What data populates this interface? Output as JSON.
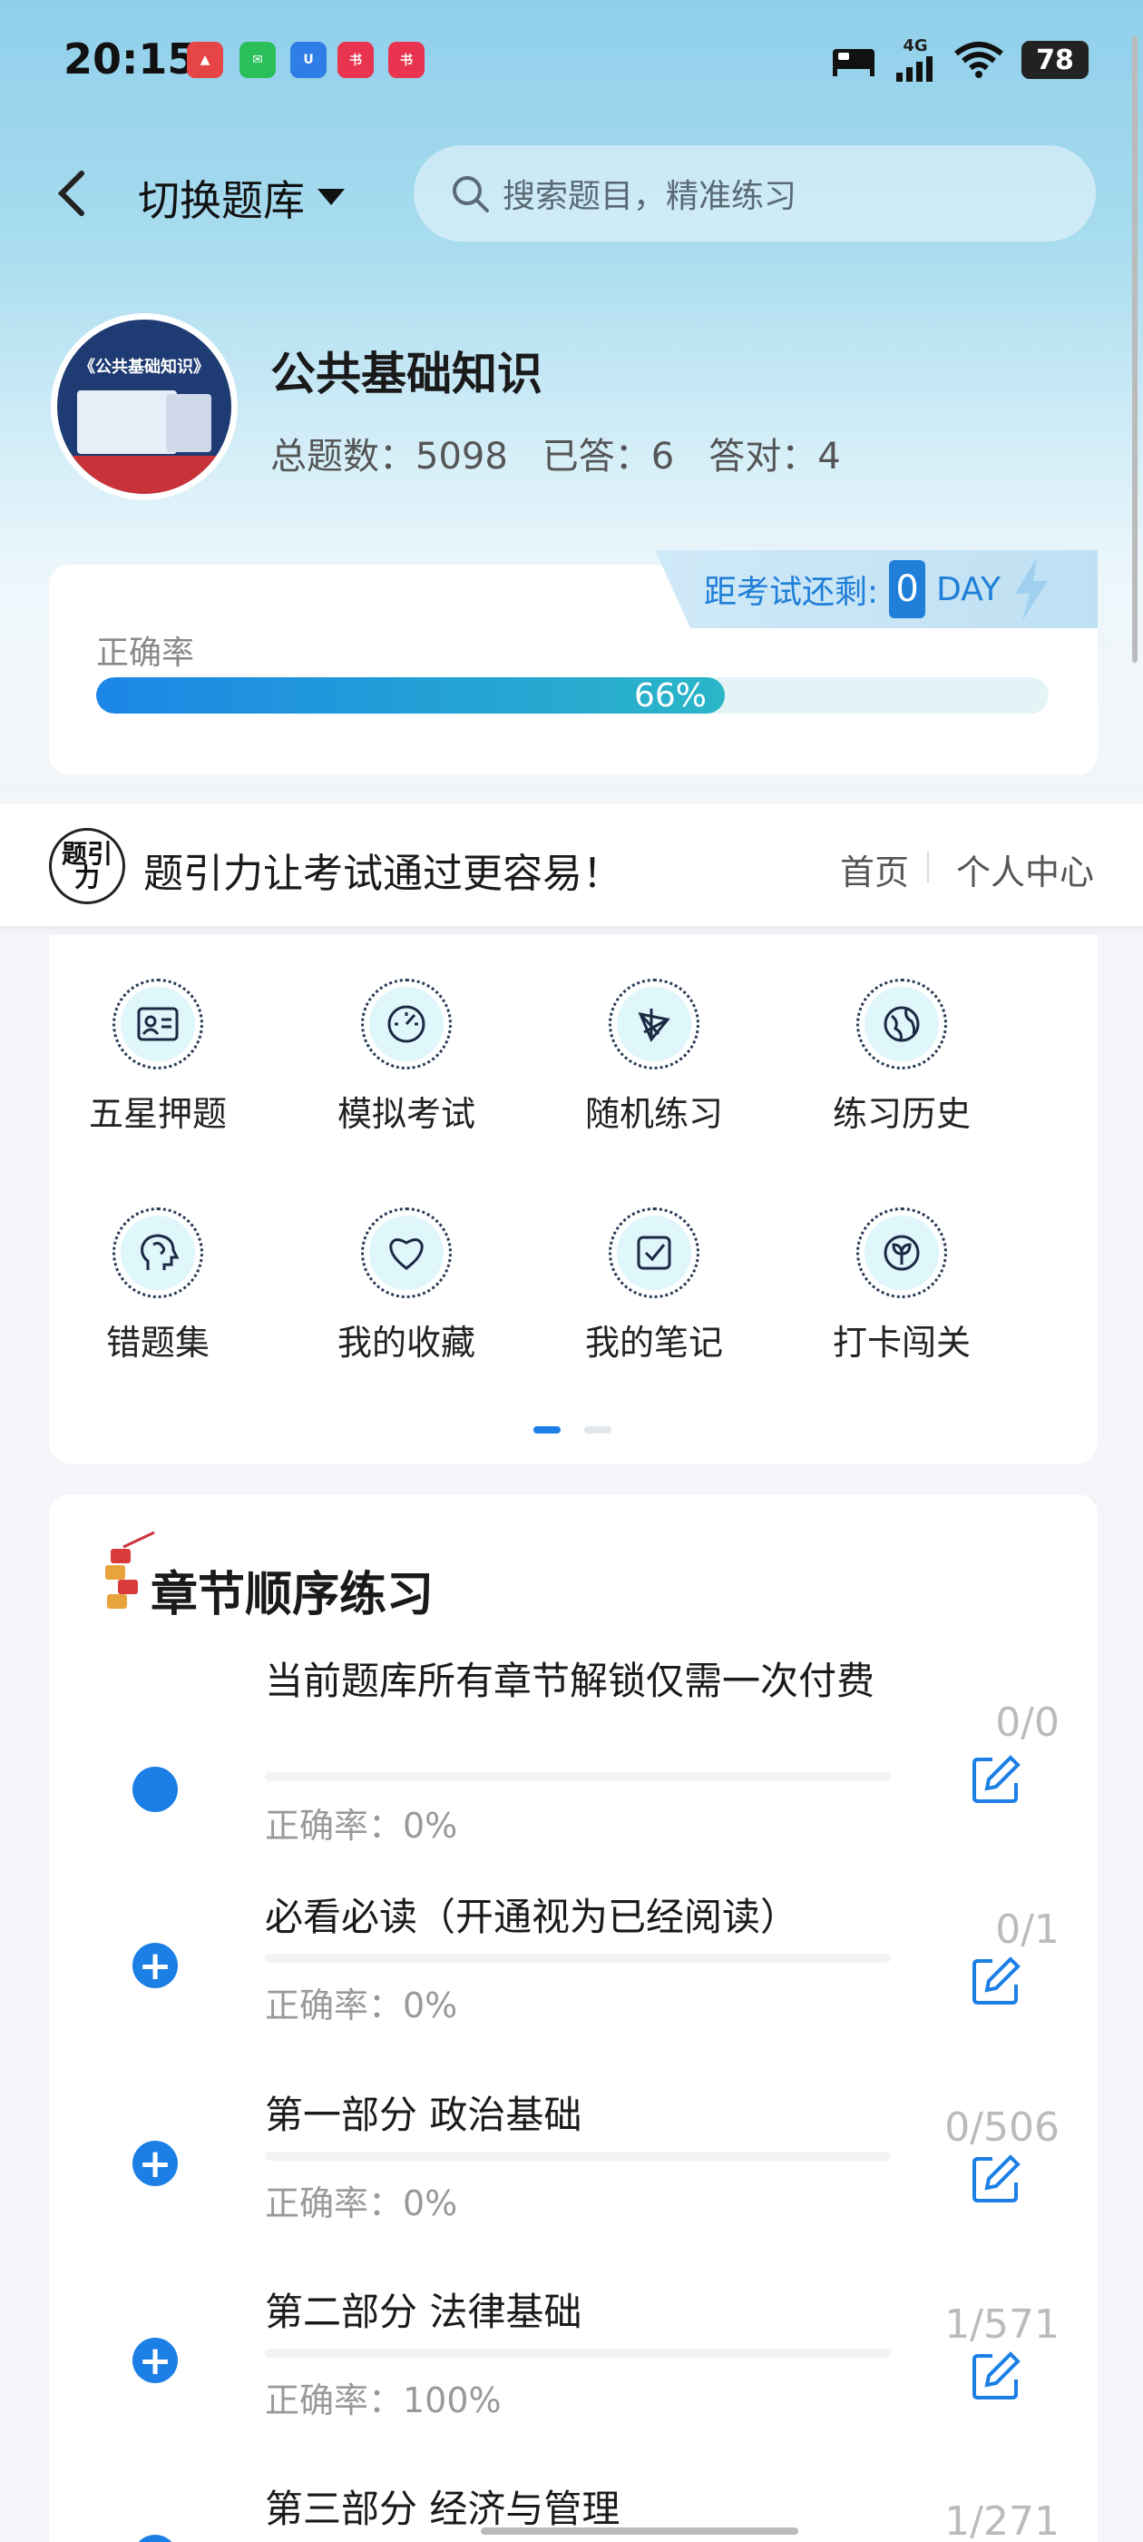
{
  "status_bar": {
    "time": "20:15",
    "network": "4G",
    "battery": "78"
  },
  "header": {
    "switch_label": "切换题库",
    "search_placeholder": "搜索题目，精准练习"
  },
  "bank": {
    "avatar_text": "《公共基础知识》",
    "title": "公共基础知识",
    "total_label": "总题数：5098",
    "answered_label": "已答：6",
    "correct_label": "答对：4"
  },
  "progress": {
    "countdown_label": "距考试还剩:",
    "countdown_value": "0",
    "countdown_unit": "DAY",
    "accuracy_label": "正确率",
    "accuracy_value": "66%",
    "accuracy_fraction": 0.66
  },
  "brand": {
    "logo_text": "题引力",
    "slogan": "题引力让考试通过更容易！",
    "nav_home": "首页",
    "nav_profile": "个人中心"
  },
  "features": [
    {
      "label": "五星押题",
      "icon": "id-card-icon"
    },
    {
      "label": "模拟考试",
      "icon": "speedometer-icon"
    },
    {
      "label": "随机练习",
      "icon": "network-icon"
    },
    {
      "label": "练习历史",
      "icon": "globe-icon"
    },
    {
      "label": "错题集",
      "icon": "brain-head-icon"
    },
    {
      "label": "我的收藏",
      "icon": "heart-icon"
    },
    {
      "label": "我的笔记",
      "icon": "checklist-icon"
    },
    {
      "label": "打卡闯关",
      "icon": "sprout-icon"
    }
  ],
  "chapters": {
    "title": "章节顺序练习",
    "items": [
      {
        "name": "当前题库所有章节解锁仅需一次付费",
        "accuracy": "正确率：0%",
        "count": "0/0"
      },
      {
        "name": "必看必读（开通视为已经阅读）",
        "accuracy": "正确率：0%",
        "count": "0/1"
      },
      {
        "name": "第一部分 政治基础",
        "accuracy": "正确率：0%",
        "count": "0/506"
      },
      {
        "name": "第二部分 法律基础",
        "accuracy": "正确率：100%",
        "count": "1/571"
      },
      {
        "name": "第三部分 经济与管理",
        "accuracy": "",
        "count": "1/271"
      }
    ]
  },
  "colors": {
    "accent": "#1b7fe6",
    "header_bg": "#8fcfea",
    "progress_end": "#2bb6c8"
  }
}
